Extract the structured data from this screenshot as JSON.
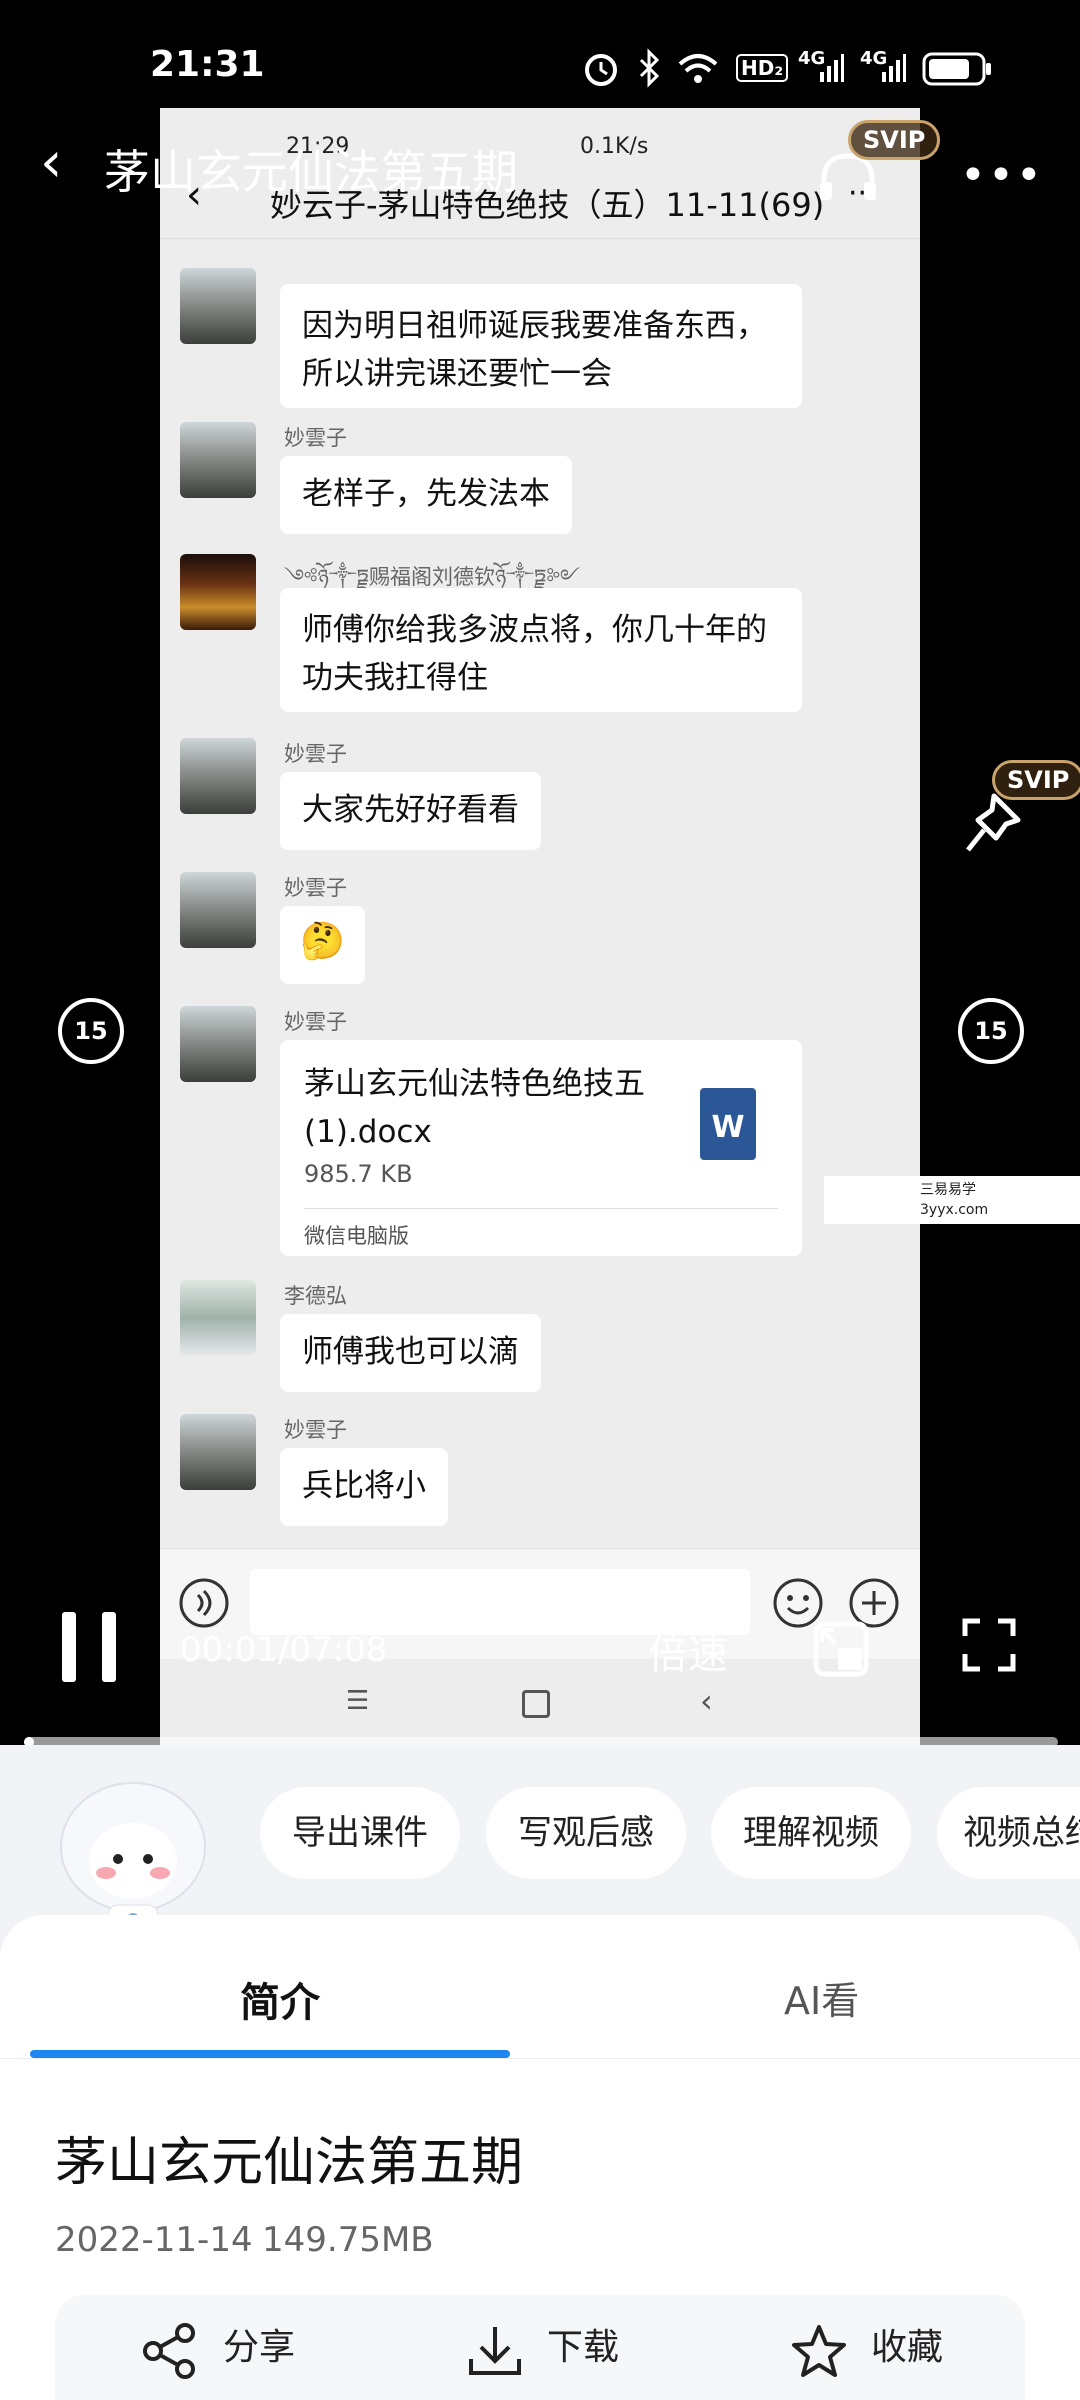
{
  "status_bar": {
    "time": "21:31",
    "hd": "HD₂",
    "net1": "4G",
    "net2": "4G"
  },
  "player": {
    "title": "茅山玄元仙法第五期",
    "svip": "SVIP",
    "skip_back": "15",
    "skip_forward": "15",
    "time": "00:01/07:08",
    "speed_label": "倍速",
    "progress_fraction": 0.003
  },
  "recorded_screen": {
    "status_time": "21:29",
    "status_speed": "0.1K/s",
    "chat_title": "妙云子-茅山特色绝技（五）11-11(69)",
    "messages": [
      {
        "sender": "",
        "text_lines": [
          "因为明日祖师诞辰我要准备东西，",
          "所以讲完课还要忙一会"
        ]
      },
      {
        "sender": "妙雲子",
        "text_lines": [
          "老样子，先发法本"
        ]
      },
      {
        "sender": "༺ཉོ༒ཏྗ赐福阁刘德钦ཉོ༒ཏྗ༻",
        "text_lines": [
          "师傅你给我多波点将，你几十年的",
          "功夫我扛得住"
        ]
      },
      {
        "sender": "妙雲子",
        "text_lines": [
          "大家先好好看看"
        ]
      },
      {
        "sender": "妙雲子",
        "text_lines": [
          "🤔"
        ]
      },
      {
        "sender": "妙雲子",
        "file": {
          "name_lines": [
            "茅山玄元仙法特色绝技五",
            "(1).docx"
          ],
          "size": "985.7 KB",
          "source": "微信电脑版",
          "icon_letter": "W"
        }
      },
      {
        "sender": "李德弘",
        "text_lines": [
          "师傅我也可以滴"
        ]
      },
      {
        "sender": "妙雲子",
        "text_lines": [
          "兵比将小"
        ]
      }
    ]
  },
  "watermark": {
    "line1": "三易易学",
    "line2": "3yyx.com"
  },
  "ai_chips": [
    "导出课件",
    "写观后感",
    "理解视频",
    "视频总结"
  ],
  "tabs": {
    "intro": "简介",
    "ai": "AI看"
  },
  "file_info": {
    "title": "茅山玄元仙法第五期",
    "date": "2022-11-14",
    "size": "149.75MB"
  },
  "actions": {
    "share": "分享",
    "download": "下载",
    "favorite": "收藏"
  },
  "colors": {
    "accent": "#1e86f0",
    "svip_border": "#c9a36a"
  }
}
